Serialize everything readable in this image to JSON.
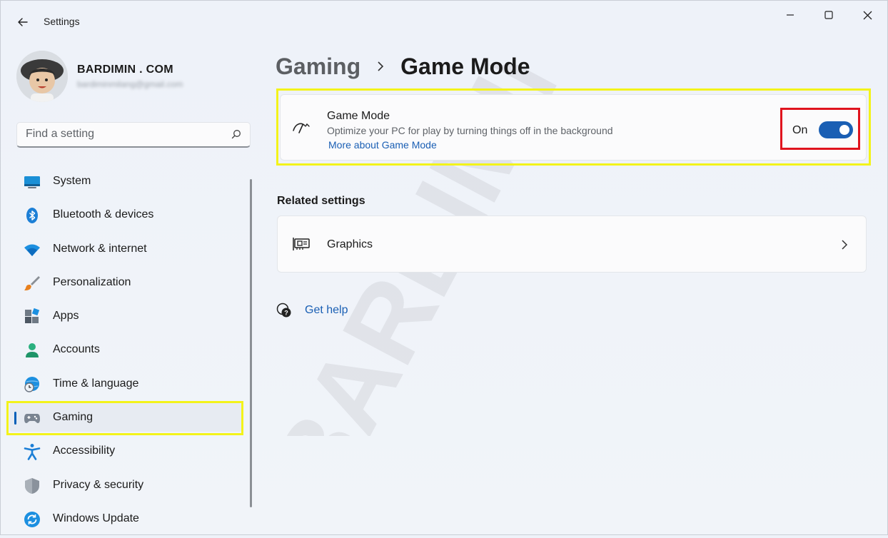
{
  "window": {
    "title": "Settings"
  },
  "user": {
    "name": "BARDIMIN . COM",
    "email": "bardiminmilang@gmail.com"
  },
  "search": {
    "placeholder": "Find a setting"
  },
  "nav": {
    "items": [
      {
        "label": "System",
        "icon": "system-icon"
      },
      {
        "label": "Bluetooth & devices",
        "icon": "bluetooth-icon"
      },
      {
        "label": "Network & internet",
        "icon": "wifi-icon"
      },
      {
        "label": "Personalization",
        "icon": "brush-icon"
      },
      {
        "label": "Apps",
        "icon": "apps-icon"
      },
      {
        "label": "Accounts",
        "icon": "person-icon"
      },
      {
        "label": "Time & language",
        "icon": "globe-clock-icon"
      },
      {
        "label": "Gaming",
        "icon": "gamepad-icon",
        "selected": true
      },
      {
        "label": "Accessibility",
        "icon": "accessibility-icon"
      },
      {
        "label": "Privacy & security",
        "icon": "shield-icon"
      },
      {
        "label": "Windows Update",
        "icon": "update-icon"
      }
    ]
  },
  "breadcrumb": {
    "parent": "Gaming",
    "current": "Game Mode"
  },
  "game_mode": {
    "title": "Game Mode",
    "description": "Optimize your PC for play by turning things off in the background",
    "link": "More about Game Mode",
    "toggle_label": "On",
    "toggle_on": true
  },
  "related": {
    "title": "Related settings",
    "items": [
      {
        "label": "Graphics",
        "icon": "graphics-card-icon"
      }
    ]
  },
  "help": {
    "label": "Get help"
  },
  "watermark": {
    "text": "BARDIMIN"
  },
  "colors": {
    "accent": "#1a5fb4",
    "highlight_yellow": "#f3f31a",
    "highlight_red": "#e0141e"
  }
}
